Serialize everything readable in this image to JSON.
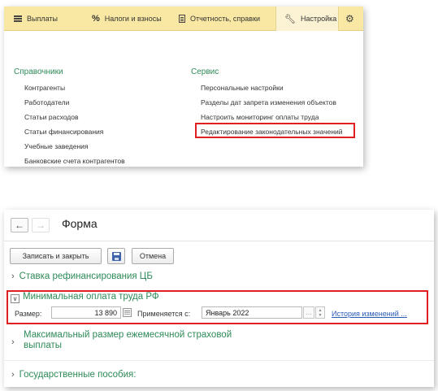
{
  "menu": {
    "tabs": [
      {
        "label": "Выплаты",
        "icon": "hamburger-icon"
      },
      {
        "label": "Налоги и взносы",
        "icon": "percent-icon"
      },
      {
        "label": "Отчетность, справки",
        "icon": "document-icon"
      },
      {
        "label": "Настройка",
        "icon": "wrench-icon",
        "active": true
      }
    ],
    "settings_icon": "gear-icon",
    "sections": {
      "directories": {
        "title": "Справочники",
        "items": [
          "Контрагенты",
          "Работодатели",
          "Статьи расходов",
          "Статьи финансирования",
          "Учебные заведения",
          "Банковские счета контрагентов"
        ]
      },
      "service": {
        "title": "Сервис",
        "items": [
          "Персональные настройки",
          "Разделы дат запрета изменения объектов",
          "Настроить мониторинг оплаты труда",
          "Редактирование законодательных значений"
        ],
        "highlighted_index": 3
      }
    },
    "colors": {
      "tabbar": "#f9e8a3",
      "section_title": "#2e8b57",
      "highlight": "#e02020"
    }
  },
  "form": {
    "nav": {
      "back": "←",
      "forward": "→"
    },
    "title": "Форма",
    "toolbar": {
      "save_close": "Записать и закрыть",
      "save_icon": "floppy-disk-icon",
      "cancel": "Отмена"
    },
    "sections": {
      "refinancing": "Ставка рефинансирования ЦБ",
      "min_wage": {
        "title": "Минимальная оплата труда РФ",
        "size_label": "Размер:",
        "size_value": "13 890",
        "applies_label": "Применяется с:",
        "applies_value": "Январь 2022",
        "history_link": "История изменений ..."
      },
      "max_monthly": {
        "line1": "Максимальный размер ежемесячной страховой",
        "line2": "выплаты"
      },
      "state_benefits": "Государственные пособия:"
    },
    "colors": {
      "section_title": "#2e8b57",
      "link": "#2a5bb5",
      "highlight": "#e02020"
    }
  }
}
